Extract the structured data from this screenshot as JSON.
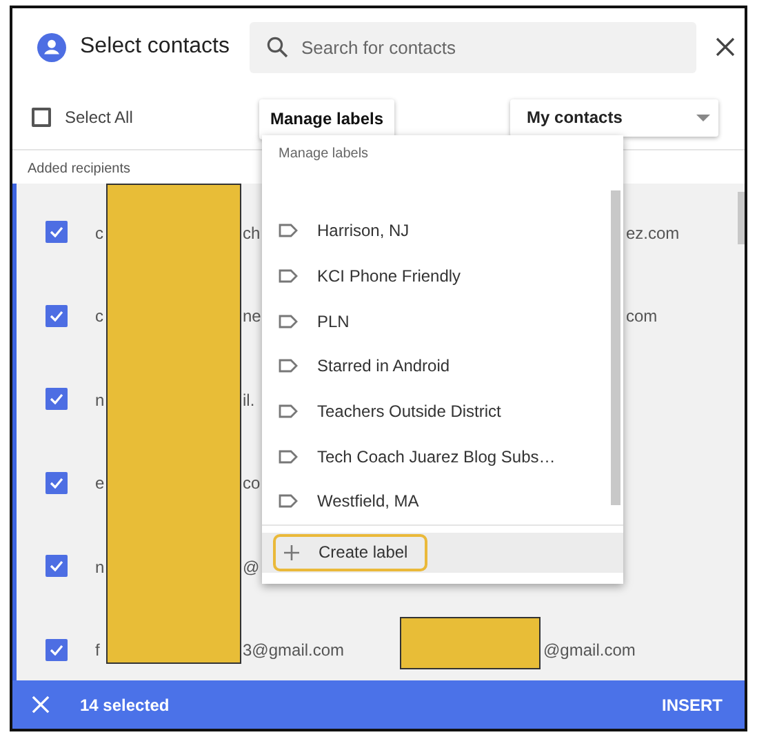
{
  "header": {
    "title": "Select contacts",
    "search": {
      "placeholder": "Search for contacts"
    }
  },
  "toolbar": {
    "select_all": {
      "label": "Select All",
      "checked": false
    },
    "manage_labels_button": "Manage labels",
    "group_dropdown": {
      "value": "My contacts"
    }
  },
  "section_label": "Added recipients",
  "contacts": [
    {
      "checked": true,
      "lead": "c",
      "middle": "ch",
      "trail": "ez.com"
    },
    {
      "checked": true,
      "lead": "c",
      "middle": "ne",
      "trail": "com"
    },
    {
      "checked": true,
      "lead": "n",
      "middle": "il."
    },
    {
      "checked": true,
      "lead": "e",
      "middle": "co"
    },
    {
      "checked": true,
      "lead": "n",
      "middle": "@"
    },
    {
      "checked": true,
      "lead": "f",
      "middle": "3@gmail.com",
      "second_email": "@gmail.com"
    }
  ],
  "label_menu": {
    "heading": "Manage labels",
    "labels": [
      "Harrison, NJ",
      "KCI Phone Friendly",
      "PLN",
      "Starred in Android",
      "Teachers Outside District",
      "Tech Coach Juarez Blog Subs…",
      "Westfield, MA"
    ],
    "create_button": {
      "label": "Create label",
      "highlighted": true
    }
  },
  "footer": {
    "selected_count": "14 selected",
    "insert_button": "INSERT"
  }
}
